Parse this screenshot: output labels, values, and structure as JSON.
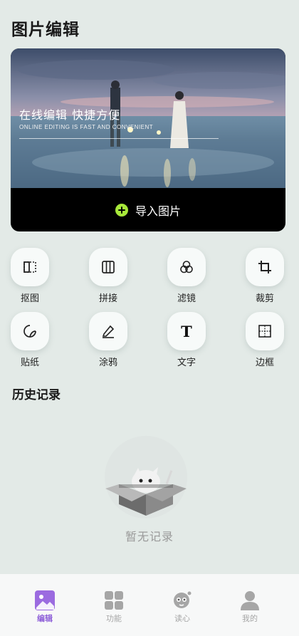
{
  "header": {
    "title": "图片编辑"
  },
  "hero": {
    "headline": "在线编辑 快捷方便",
    "subline": "ONLINE EDITING IS FAST AND CONVENIENT",
    "import_label": "导入图片"
  },
  "tools": [
    {
      "label": "抠图",
      "icon": "cutout-icon"
    },
    {
      "label": "拼接",
      "icon": "columns-icon"
    },
    {
      "label": "滤镜",
      "icon": "filter-circles-icon"
    },
    {
      "label": "裁剪",
      "icon": "crop-icon"
    },
    {
      "label": "贴纸",
      "icon": "sticker-icon"
    },
    {
      "label": "涂鸦",
      "icon": "pen-icon"
    },
    {
      "label": "文字",
      "icon": "text-icon"
    },
    {
      "label": "边框",
      "icon": "frame-icon"
    }
  ],
  "history": {
    "title": "历史记录",
    "empty_text": "暂无记录"
  },
  "tabbar": {
    "items": [
      {
        "label": "编辑",
        "active": true
      },
      {
        "label": "功能",
        "active": false
      },
      {
        "label": "读心",
        "active": false
      },
      {
        "label": "我的",
        "active": false
      }
    ]
  },
  "colors": {
    "background": "#e3eae7",
    "accent": "#8e5fd8",
    "import_plus": "#a7e83a"
  }
}
